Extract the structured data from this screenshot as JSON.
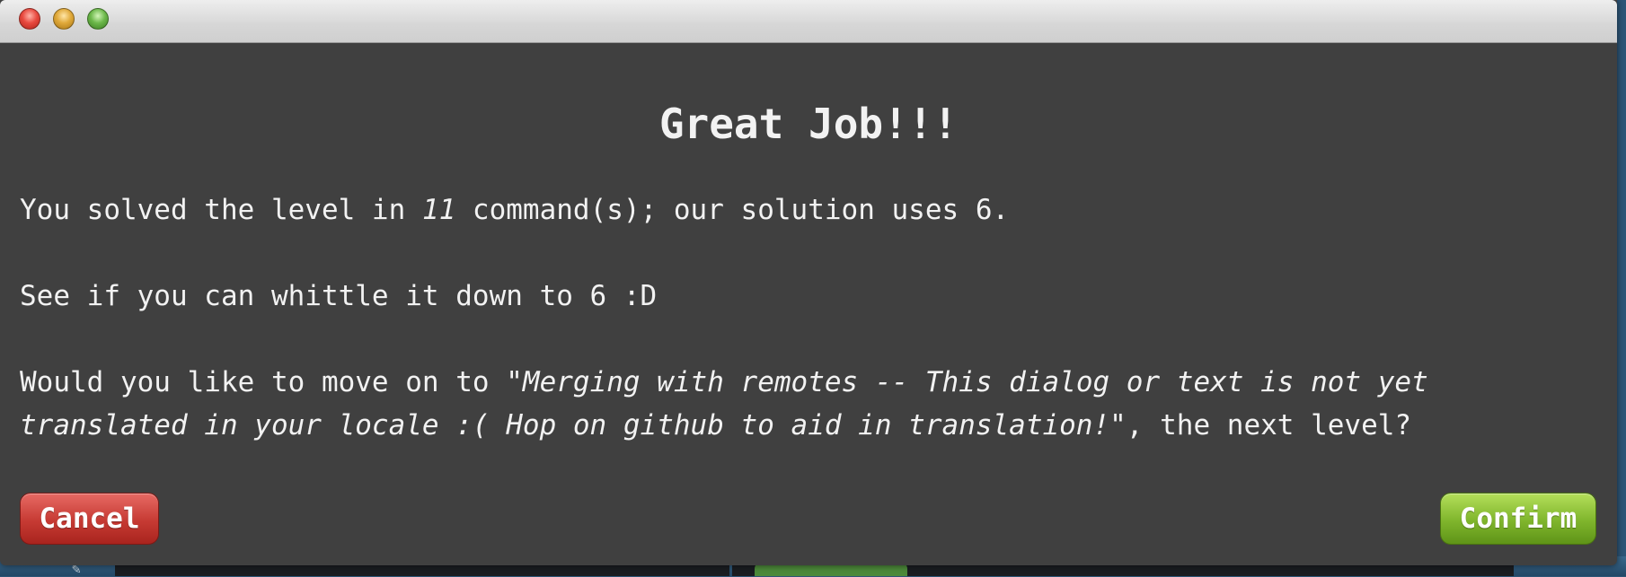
{
  "dialog": {
    "heading": "Great Job!!!",
    "solved": {
      "prefix": "You solved the level in ",
      "user_count": "11",
      "suffix": " command(s); our solution uses 6."
    },
    "whittle": "See if you can whittle it down to 6 :D",
    "next": {
      "prefix": "Would you like to move on to \"",
      "level_name": "Merging with remotes -- This dialog or text is not yet translated in your locale :( Hop on github to aid in translation!",
      "suffix": "\", the next level?"
    },
    "cancel_label": "Cancel",
    "confirm_label": "Confirm"
  },
  "colors": {
    "dialog_background": "#404040",
    "cancel_button": "#c63a33",
    "confirm_button": "#7fb52c",
    "text": "#f2f2f2"
  },
  "icons": {
    "window_controls": [
      "close-icon",
      "minimize-icon",
      "zoom-icon"
    ]
  }
}
